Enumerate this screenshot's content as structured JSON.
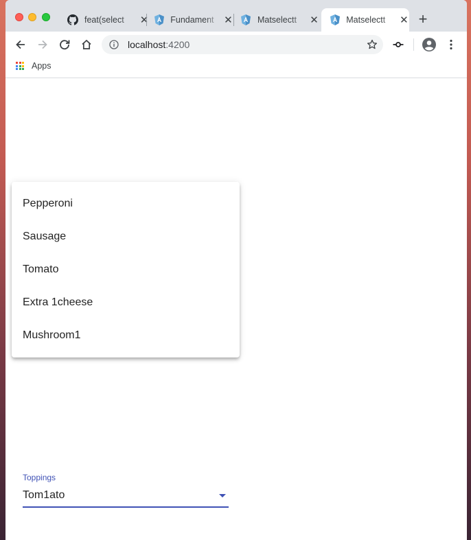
{
  "colors": {
    "accent": "#3f51b5",
    "tabstrip": "#dee1e6"
  },
  "browser": {
    "tabs": [
      {
        "title": "feat(select",
        "icon": "github-icon",
        "active": false
      },
      {
        "title": "Fundament",
        "icon": "angular-icon",
        "active": false
      },
      {
        "title": "Matselectt",
        "icon": "angular-icon",
        "active": false
      },
      {
        "title": "Matselectt",
        "icon": "angular-icon",
        "active": true
      }
    ],
    "url_host": "localhost",
    "url_port": ":4200",
    "bookmarks": {
      "apps_label": "Apps"
    }
  },
  "select": {
    "label": "Toppings",
    "value": "Tom1ato",
    "options": [
      "Pepperoni",
      "Sausage",
      "Tomato",
      "Extra 1cheese",
      "Mushroom1"
    ]
  }
}
